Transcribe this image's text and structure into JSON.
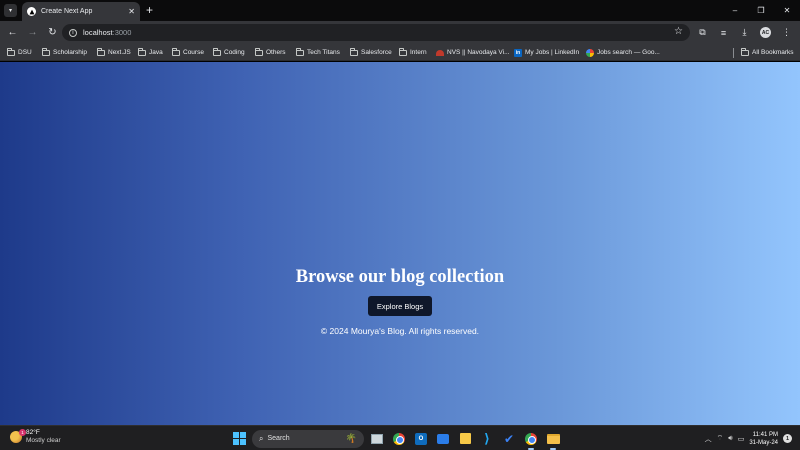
{
  "browser": {
    "tab_title": "Create Next App",
    "url_host": "localhost",
    "url_port": ":3000",
    "new_tab_label": "+",
    "tab_close_label": "✕",
    "window_controls": {
      "minimize": "–",
      "maximize": "❐",
      "close": "✕"
    }
  },
  "bookmarks": [
    {
      "label": "DSU",
      "icon": "folder-icon"
    },
    {
      "label": "Scholarship",
      "icon": "folder-icon"
    },
    {
      "label": "Next.JS",
      "icon": "folder-icon"
    },
    {
      "label": "Java",
      "icon": "folder-icon"
    },
    {
      "label": "Course",
      "icon": "folder-icon"
    },
    {
      "label": "Coding",
      "icon": "folder-icon"
    },
    {
      "label": "Others",
      "icon": "folder-icon"
    },
    {
      "label": "Tech Titans",
      "icon": "folder-icon"
    },
    {
      "label": "Salesforce",
      "icon": "folder-icon"
    },
    {
      "label": "Intern",
      "icon": "folder-icon"
    },
    {
      "label": "NVS || Navodaya Vi...",
      "icon": "nvs-favicon"
    },
    {
      "label": "My Jobs | LinkedIn",
      "icon": "linkedin-icon"
    },
    {
      "label": "Jobs search — Goo...",
      "icon": "google-icon"
    },
    {
      "label": "All Bookmarks",
      "icon": "folder-icon"
    }
  ],
  "page": {
    "title": "Browse our blog collection",
    "button_label": "Explore Blogs",
    "footer": "© 2024 Mourya's Blog. All rights reserved."
  },
  "taskbar": {
    "temperature": "82°F",
    "condition": "Mostly clear",
    "weather_badge": "1",
    "search_label": "Search",
    "time": "11:41 PM",
    "date": "31-May-24",
    "notifications": "1",
    "profile_initials": "AC"
  },
  "colors": {
    "gradient_start": "#1e3a8a",
    "gradient_end": "#93c5fd",
    "button_bg": "#0f172a"
  }
}
